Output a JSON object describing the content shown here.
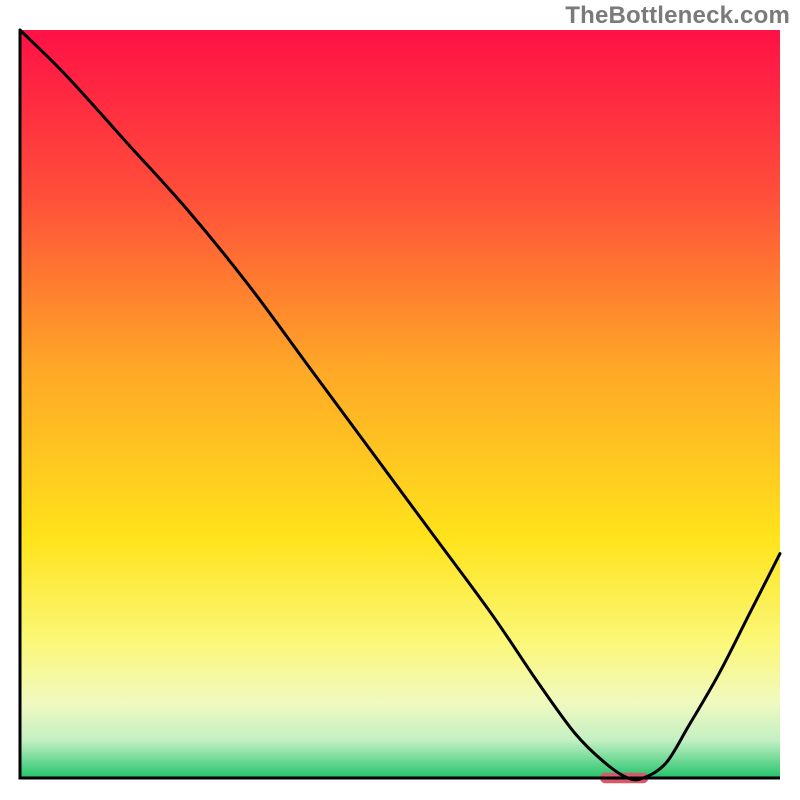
{
  "meta": {
    "watermark": "TheBottleneck.com"
  },
  "chart_data": {
    "type": "line",
    "title": "",
    "xlabel": "",
    "ylabel": "",
    "xlim": [
      0,
      100
    ],
    "ylim": [
      0,
      100
    ],
    "background_gradient": [
      {
        "t": 0.0,
        "color": "#ff1146"
      },
      {
        "t": 0.22,
        "color": "#ff4e3a"
      },
      {
        "t": 0.45,
        "color": "#ffa727"
      },
      {
        "t": 0.68,
        "color": "#ffe31b"
      },
      {
        "t": 0.82,
        "color": "#fbf87a"
      },
      {
        "t": 0.9,
        "color": "#f0f9c0"
      },
      {
        "t": 0.95,
        "color": "#c3f0c3"
      },
      {
        "t": 1.0,
        "color": "#22c36a"
      }
    ],
    "series": [
      {
        "name": "bottleneck-curve",
        "x": [
          0,
          6,
          14,
          22,
          30,
          38,
          46,
          54,
          62,
          68,
          73,
          77,
          80,
          82,
          85,
          88,
          92,
          96,
          100
        ],
        "y": [
          100,
          94,
          85,
          76,
          66,
          55,
          44,
          33,
          22,
          13,
          6,
          2,
          0,
          0,
          2,
          7,
          14,
          22,
          30
        ]
      }
    ],
    "marker": {
      "name": "sweet-spot-marker",
      "x_start": 77,
      "x_end": 82,
      "y": 0,
      "color": "#d9596b",
      "thickness_pct": 1.4
    },
    "axes": {
      "show_ticks": false,
      "border_color": "#000000",
      "border_width": 3
    }
  }
}
